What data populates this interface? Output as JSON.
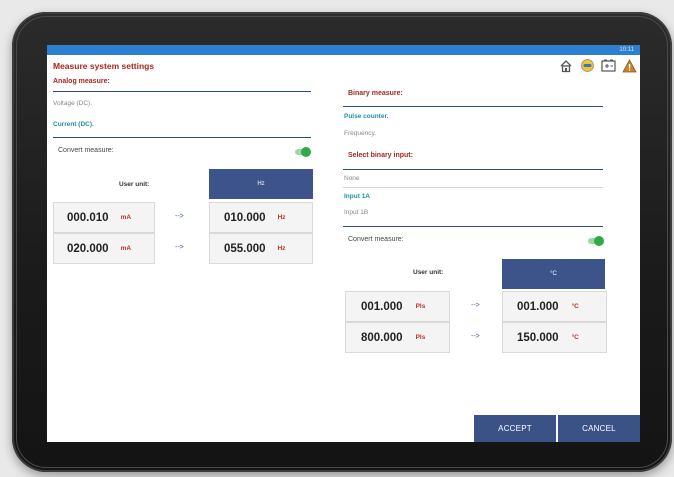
{
  "status": {
    "time": "10:11"
  },
  "header": {
    "title": "Measure system settings"
  },
  "toolbar": {
    "icons": [
      "home-icon",
      "connect-icon",
      "battery-icon",
      "warning-icon"
    ],
    "accent": "#2f7fd1"
  },
  "left": {
    "analog_title": "Analog measure:",
    "voltage": "Voltage (DC).",
    "current": "Current (DC).",
    "convert_label": "Convert measure:",
    "convert_on": true,
    "user_unit_label": "User unit:",
    "target_unit": "Hz",
    "rows": [
      {
        "in_value": "000.010",
        "in_unit": "mA",
        "arrow": "-->",
        "out_value": "010.000",
        "out_unit": "Hz"
      },
      {
        "in_value": "020.000",
        "in_unit": "mA",
        "arrow": "-->",
        "out_value": "055.000",
        "out_unit": "Hz"
      }
    ]
  },
  "right": {
    "binary_title": "Binary measure:",
    "pulse": "Pulse counter.",
    "frequency": "Frequency.",
    "select_title": "Select binary input:",
    "none": "None",
    "input_1a": "Input 1A",
    "input_1b": "Input 1B",
    "convert_label": "Convert measure:",
    "convert_on": true,
    "user_unit_label": "User unit:",
    "target_unit": "°C",
    "rows": [
      {
        "in_value": "001.000",
        "in_unit": "Pls",
        "arrow": "-->",
        "out_value": "001.000",
        "out_unit": "°C"
      },
      {
        "in_value": "800.000",
        "in_unit": "Pls",
        "arrow": "-->",
        "out_value": "150.000",
        "out_unit": "°C"
      }
    ]
  },
  "footer": {
    "accept_label": "ACCEPT",
    "cancel_label": "CANCEL"
  }
}
